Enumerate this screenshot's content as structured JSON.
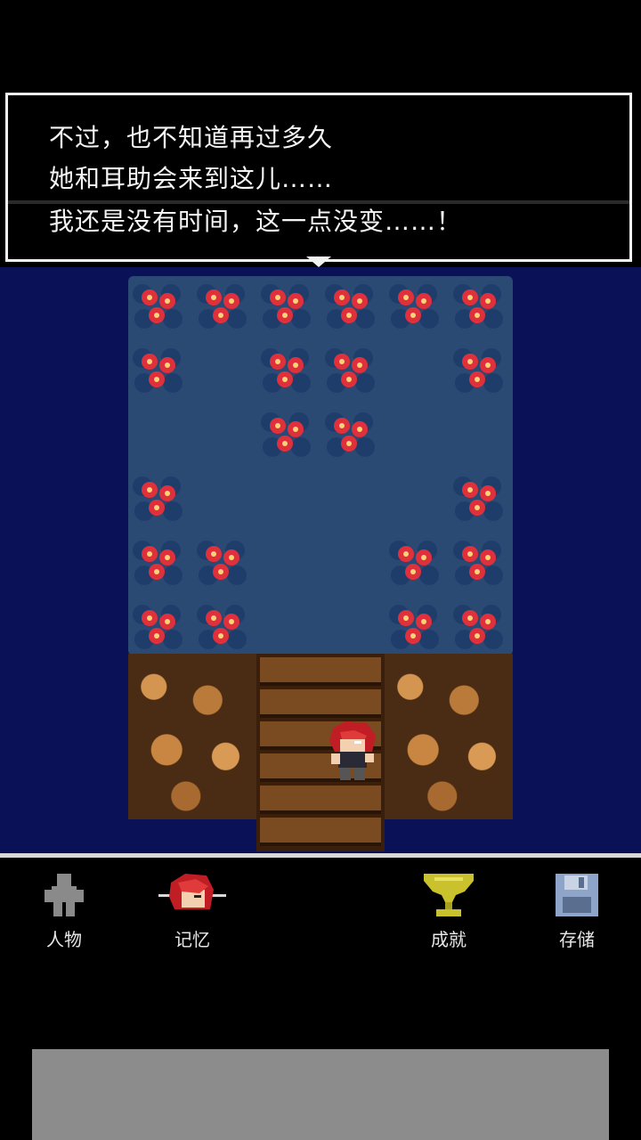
{
  "dialog": {
    "lines": [
      "不过，也不知道再过多久",
      "她和耳助会来到这儿……",
      "我还是没有时间，这一点没变……！"
    ],
    "continue_indicator": "down-triangle-icon"
  },
  "hud": {
    "buttons": [
      {
        "id": "characters",
        "label": "人物",
        "icon": "person-silhouette-icon"
      },
      {
        "id": "memory",
        "label": "记忆",
        "icon": "red-hair-portrait-icon"
      },
      {
        "id": "achievements",
        "label": "成就",
        "icon": "trophy-icon"
      },
      {
        "id": "save",
        "label": "存储",
        "icon": "floppy-disk-icon"
      }
    ]
  },
  "colors": {
    "water": "#0b1157",
    "garden_floor": "#2a4a74",
    "flower": "#e0303c",
    "trophy": "#c9c22c",
    "floppy": "#8ea4c8"
  }
}
